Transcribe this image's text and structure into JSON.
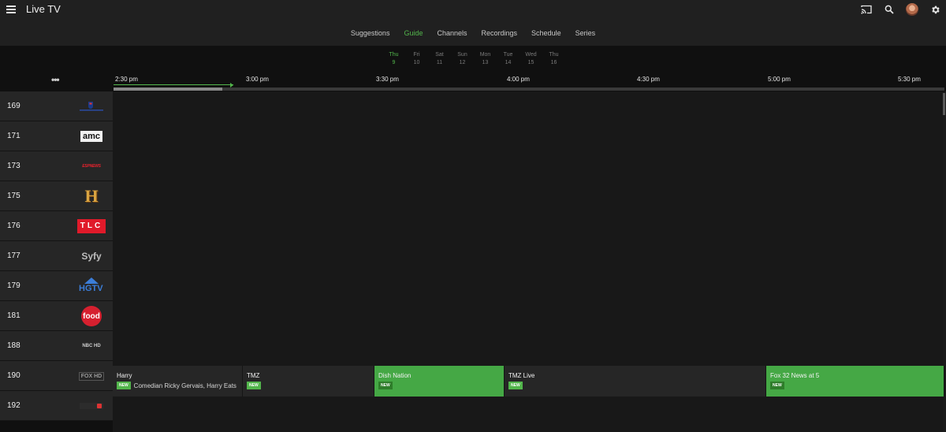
{
  "header": {
    "title": "Live TV"
  },
  "tabs": [
    {
      "label": "Suggestions",
      "active": false
    },
    {
      "label": "Guide",
      "active": true
    },
    {
      "label": "Channels",
      "active": false
    },
    {
      "label": "Recordings",
      "active": false
    },
    {
      "label": "Schedule",
      "active": false
    },
    {
      "label": "Series",
      "active": false
    }
  ],
  "days": [
    {
      "name": "Thu",
      "date": "9",
      "active": true
    },
    {
      "name": "Fri",
      "date": "10"
    },
    {
      "name": "Sat",
      "date": "11"
    },
    {
      "name": "Sun",
      "date": "12"
    },
    {
      "name": "Mon",
      "date": "13"
    },
    {
      "name": "Tue",
      "date": "14"
    },
    {
      "name": "Wed",
      "date": "15"
    },
    {
      "name": "Thu",
      "date": "16"
    }
  ],
  "options_label": "•••",
  "times": [
    "2:30 pm",
    "3:00 pm",
    "3:30 pm",
    "4:00 pm",
    "4:30 pm",
    "5:00 pm",
    "5:30 pm"
  ],
  "channels": [
    {
      "number": "169",
      "logo": "nfl-network"
    },
    {
      "number": "171",
      "logo": "amc",
      "logo_text": "amc"
    },
    {
      "number": "173",
      "logo": "espnews",
      "logo_text": "ESPNEWS"
    },
    {
      "number": "175",
      "logo": "history",
      "logo_text": "H"
    },
    {
      "number": "176",
      "logo": "tlc",
      "logo_text": "TLC"
    },
    {
      "number": "177",
      "logo": "syfy",
      "logo_text": "Syfy"
    },
    {
      "number": "179",
      "logo": "hgtv",
      "logo_text": "HGTV"
    },
    {
      "number": "181",
      "logo": "food-network",
      "logo_text": "food"
    },
    {
      "number": "188",
      "logo": "nbc-hd",
      "logo_text": "NBC HD"
    },
    {
      "number": "190",
      "logo": "fox-hd",
      "logo_text": "FOX HD"
    },
    {
      "number": "192",
      "logo": "unknown"
    }
  ],
  "programs": [
    {
      "title": "Harry",
      "badge": "NEW",
      "description": "Comedian Ricky Gervais, Harry Eats",
      "green": false
    },
    {
      "title": "TMZ",
      "badge": "NEW",
      "description": "",
      "green": false
    },
    {
      "title": "Dish Nation",
      "badge": "NEW",
      "description": "",
      "green": true
    },
    {
      "title": "TMZ Live",
      "badge": "NEW",
      "description": "",
      "green": false
    },
    {
      "title": "Fox 32 News at 5",
      "badge": "NEW",
      "description": "",
      "green": true
    }
  ],
  "colors": {
    "accent": "#52b54b",
    "header": "#202020",
    "row": "#262626"
  }
}
